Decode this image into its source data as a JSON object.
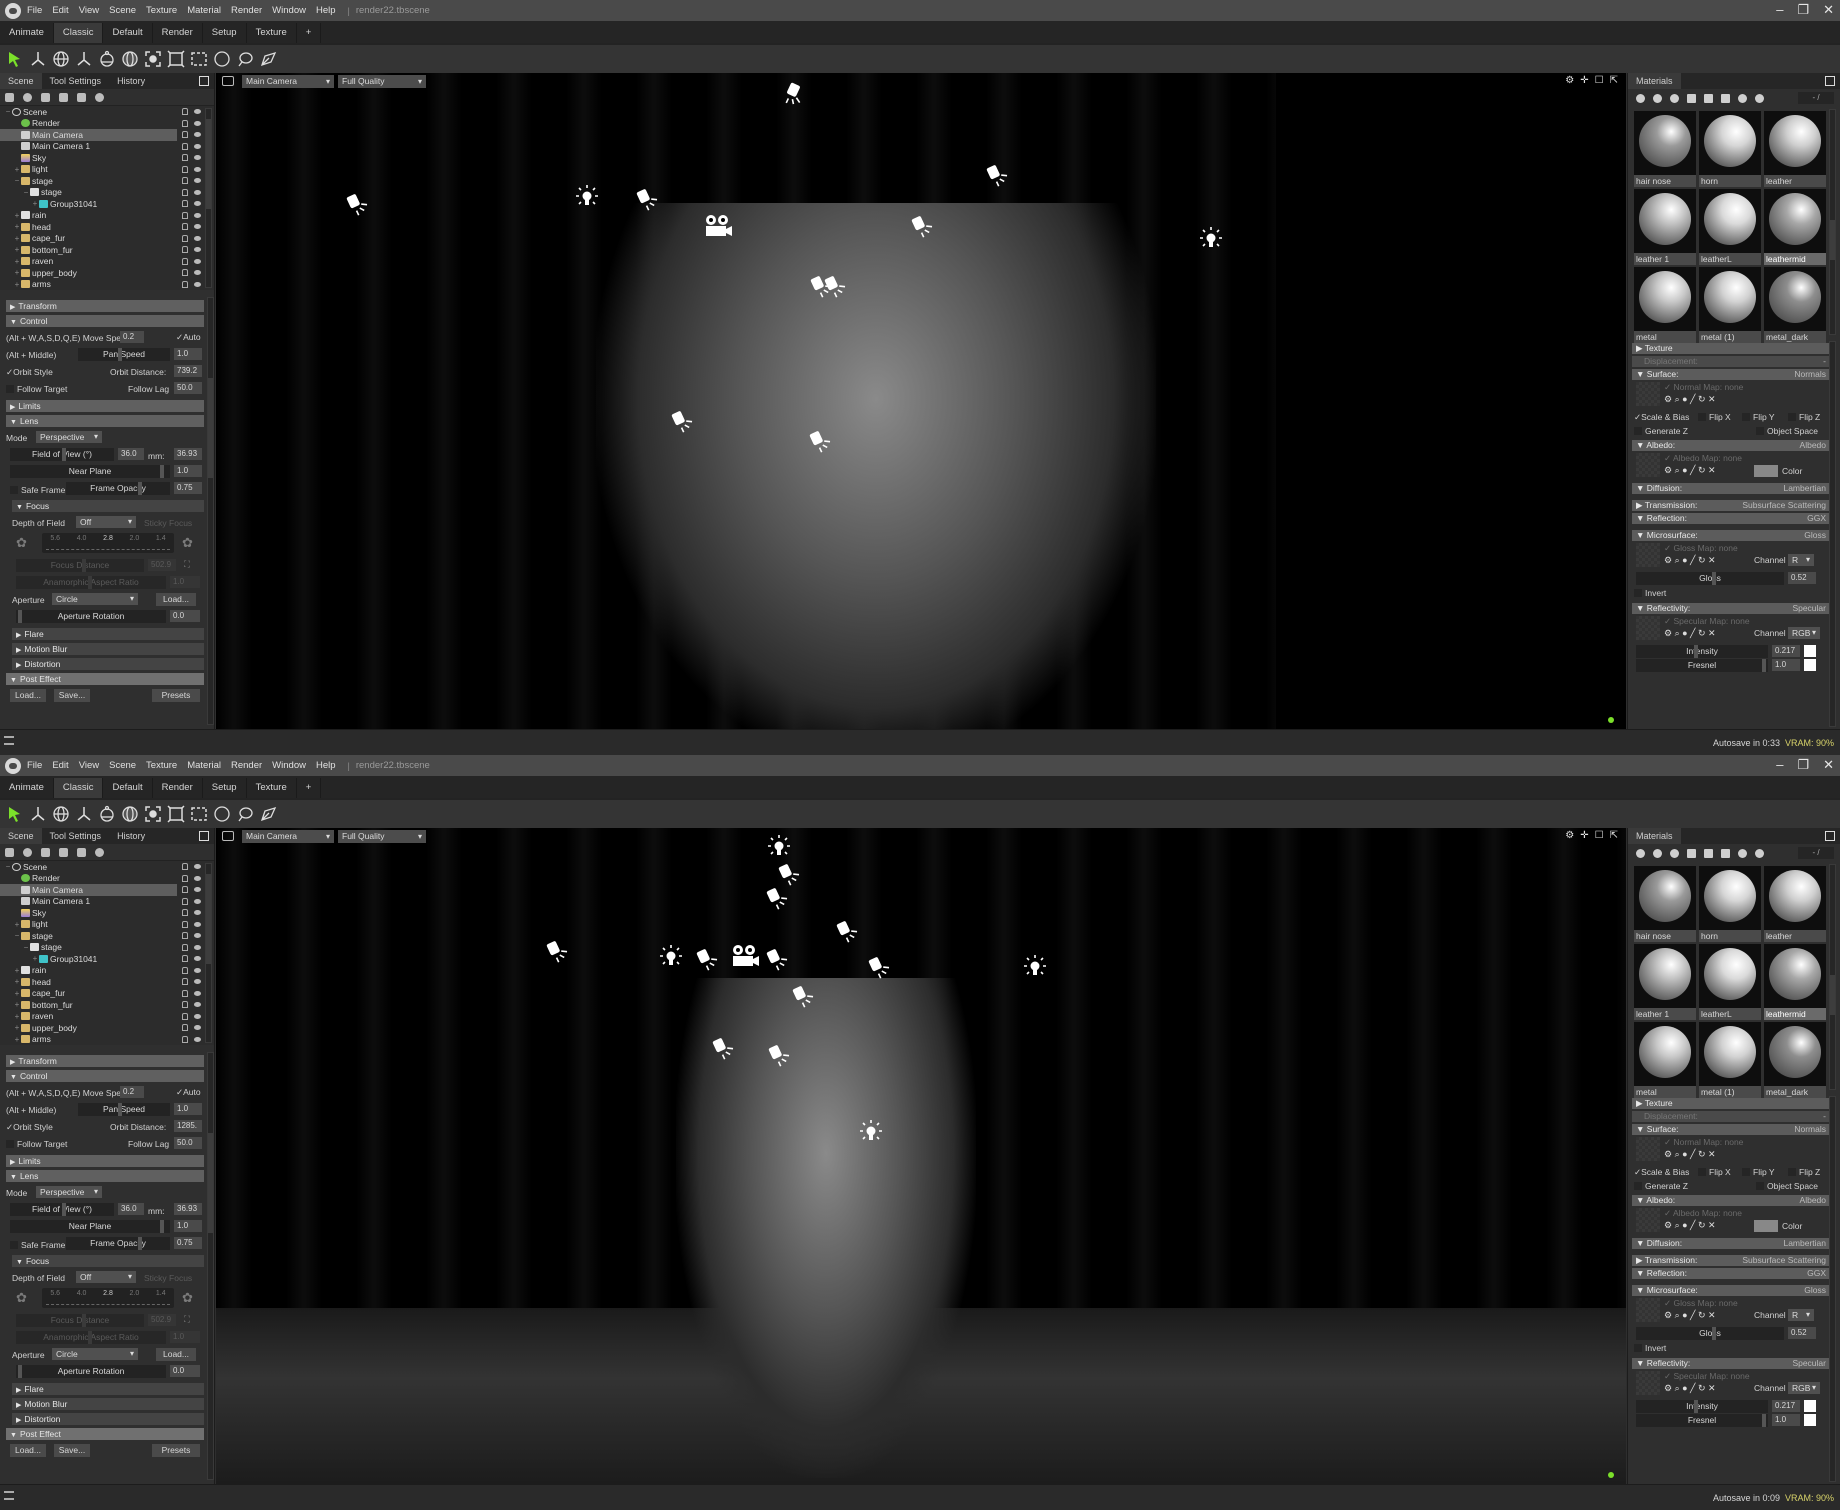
{
  "menu": {
    "items": [
      "File",
      "Edit",
      "View",
      "Scene",
      "Texture",
      "Material",
      "Render",
      "Window",
      "Help"
    ],
    "file_name": "render22.tbscene"
  },
  "workspace_tabs": [
    "Animate",
    "Classic",
    "Default",
    "Render",
    "Setup",
    "Texture",
    "+"
  ],
  "active_workspace": "Classic",
  "toolbar_tools": [
    "select-tool",
    "translate-tool",
    "rotate-tool",
    "scale-tool",
    "camera-orbit-tool",
    "sphere-select-tool",
    "focus-tool",
    "frame-tool",
    "rect-select-tool",
    "circle-select-tool",
    "lasso-tool",
    "paint-select-tool"
  ],
  "left_panel": {
    "tabs": [
      "Scene",
      "Tool Settings",
      "History"
    ],
    "tree": [
      {
        "label": "Scene",
        "type": "scene",
        "depth": 0,
        "expander": "−"
      },
      {
        "label": "Render",
        "type": "gear",
        "depth": 1,
        "expander": ""
      },
      {
        "label": "Main Camera",
        "type": "cam",
        "depth": 1,
        "expander": "",
        "selected": true
      },
      {
        "label": "Main Camera 1",
        "type": "cam",
        "depth": 1,
        "expander": ""
      },
      {
        "label": "Sky",
        "type": "sky",
        "depth": 1,
        "expander": ""
      },
      {
        "label": "light",
        "type": "folder",
        "depth": 1,
        "expander": "+"
      },
      {
        "label": "stage",
        "type": "folder",
        "depth": 1,
        "expander": "−"
      },
      {
        "label": "stage",
        "type": "obj",
        "depth": 2,
        "expander": "−"
      },
      {
        "label": "Group31041",
        "type": "grp",
        "depth": 3,
        "expander": "+"
      },
      {
        "label": "rain",
        "type": "obj",
        "depth": 1,
        "expander": "+"
      },
      {
        "label": "head",
        "type": "folder",
        "depth": 1,
        "expander": "+"
      },
      {
        "label": "cape_fur",
        "type": "folder",
        "depth": 1,
        "expander": "+"
      },
      {
        "label": "bottom_fur",
        "type": "folder",
        "depth": 1,
        "expander": "+"
      },
      {
        "label": "raven",
        "type": "folder",
        "depth": 1,
        "expander": "+"
      },
      {
        "label": "upper_body",
        "type": "folder",
        "depth": 1,
        "expander": "+"
      },
      {
        "label": "arms",
        "type": "folder",
        "depth": 1,
        "expander": "+"
      }
    ],
    "sections": {
      "transform": "Transform",
      "control": "Control",
      "limits": "Limits",
      "lens": "Lens",
      "focus": "Focus",
      "flare": "Flare",
      "motion_blur": "Motion Blur",
      "distortion": "Distortion",
      "post_effect": "Post Effect"
    },
    "control": {
      "move_hint": "(Alt + W,A,S,D,Q,E) Move Speed:",
      "move_speed": "0.2",
      "auto_label": "Auto",
      "pan_hint": "(Alt + Middle)",
      "pan_speed_label": "Pan Speed",
      "pan_speed": "1.0",
      "orbit_style_label": "Orbit Style",
      "orbit_distance_label": "Orbit Distance:",
      "follow_target_label": "Follow Target",
      "follow_lag_label": "Follow Lag",
      "follow_lag": "50.0"
    },
    "lens": {
      "mode_label": "Mode",
      "mode": "Perspective",
      "fov_label": "Field of View (°)",
      "fov": "36.0",
      "mm_label": "mm:",
      "mm": "36.93",
      "near_plane_label": "Near Plane",
      "near_plane": "1.0",
      "safe_frame_label": "Safe Frame",
      "frame_opacity_label": "Frame Opacity",
      "frame_opacity": "0.75"
    },
    "focus": {
      "dof_label": "Depth of Field",
      "dof": "Off",
      "sticky_focus_label": "Sticky Focus",
      "fstops": [
        "5.6",
        "4.0",
        "2.8",
        "2.0",
        "1.4"
      ],
      "focus_distance_label": "Focus Distance",
      "focus_distance": "502.9",
      "anamorphic_label": "Anamorphic Aspect Ratio",
      "anamorphic": "1.0",
      "aperture_label": "Aperture",
      "aperture": "Circle",
      "load_label": "Load...",
      "aperture_rotation_label": "Aperture Rotation",
      "aperture_rotation": "0.0"
    },
    "post_effect_buttons": [
      "Load...",
      "Save...",
      "Presets"
    ]
  },
  "viewport": {
    "camera": "Main Camera",
    "quality": "Full Quality"
  },
  "materials": {
    "tab": "Materials",
    "count": "- /",
    "items": [
      {
        "name": "hair nose",
        "tone": "#9a9a9a"
      },
      {
        "name": "horn",
        "tone": "#d6d6d6"
      },
      {
        "name": "leather",
        "tone": "#cfcfcf"
      },
      {
        "name": "leather 1",
        "tone": "#c2c2c2"
      },
      {
        "name": "leatherL",
        "tone": "#dadada"
      },
      {
        "name": "leathermid",
        "tone": "#a8a8a8",
        "selected": true
      },
      {
        "name": "metal",
        "tone": "#c8c8c8"
      },
      {
        "name": "metal (1)",
        "tone": "#d2d2d2"
      },
      {
        "name": "metal_dark",
        "tone": "#8e8e8e"
      }
    ],
    "props": {
      "texture": "Texture",
      "displacement": "Displacement:",
      "displacement_value": "-",
      "surface": "Surface:",
      "surface_value": "Normals",
      "normal_map": "Normal Map: none",
      "scale_bias": "Scale & Bias",
      "flip_x": "Flip X",
      "flip_y": "Flip Y",
      "flip_z": "Flip Z",
      "generate_z": "Generate Z",
      "object_space": "Object Space",
      "albedo": "Albedo:",
      "albedo_value": "Albedo",
      "albedo_map": "Albedo Map: none",
      "color_label": "Color",
      "diffusion": "Diffusion:",
      "diffusion_value": "Lambertian",
      "transmission": "Transmission:",
      "transmission_value": "Subsurface Scattering",
      "reflection": "Reflection:",
      "reflection_value": "GGX",
      "microsurface": "Microsurface:",
      "microsurface_value": "Gloss",
      "gloss_map": "Gloss Map: none",
      "channel_label": "Channel",
      "gloss_channel": "R",
      "gloss_label": "Gloss",
      "gloss": "0.52",
      "invert_label": "Invert",
      "reflectivity": "Reflectivity:",
      "reflectivity_value": "Specular",
      "specular_map": "Specular Map: none",
      "spec_channel": "RGB",
      "intensity_label": "Intensity",
      "intensity": "0.217",
      "fresnel_label": "Fresnel",
      "fresnel": "1.0"
    }
  },
  "windows": [
    {
      "orbit_distance": "739.2",
      "autosave": "Autosave in 0:33",
      "vram": "VRAM: 90%"
    },
    {
      "orbit_distance": "1285.",
      "autosave": "Autosave in 0:09",
      "vram": "VRAM: 90%"
    }
  ],
  "colors": {
    "accent_green": "#7be02a",
    "vram_yellow": "#d8d36a",
    "selection": "#5e5e5e"
  }
}
